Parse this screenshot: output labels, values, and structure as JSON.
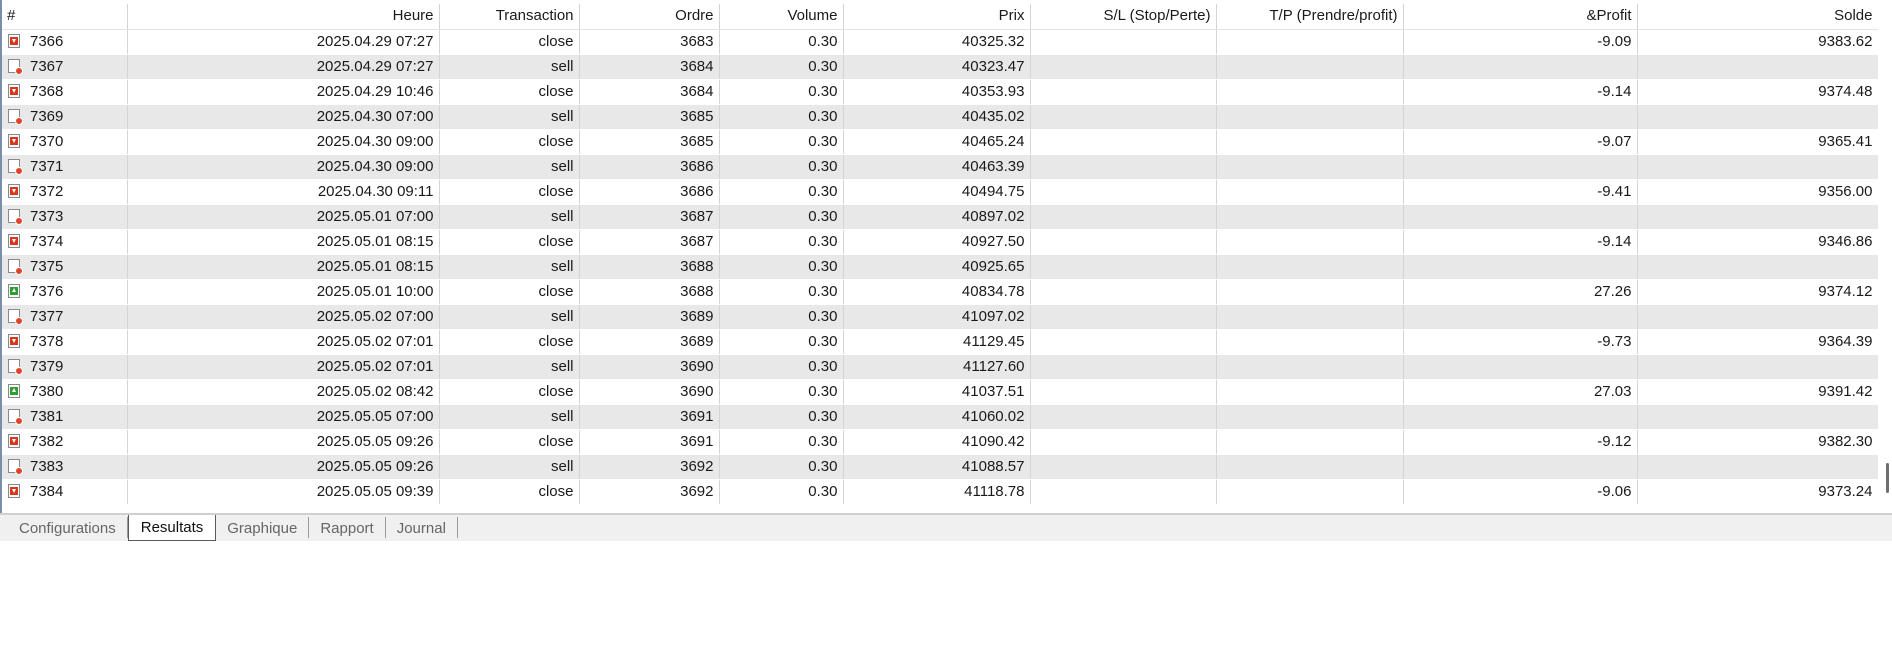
{
  "table": {
    "headers": {
      "id": "#",
      "time": "Heure",
      "transaction": "Transaction",
      "order": "Ordre",
      "volume": "Volume",
      "price": "Prix",
      "sl": "S/L (Stop/Perte)",
      "tp": "T/P (Prendre/profit)",
      "profit": "&Profit",
      "balance": "Solde"
    },
    "rows": [
      {
        "id": "7366",
        "icon": "loss",
        "time": "2025.04.29 07:27",
        "transaction": "close",
        "order": "3683",
        "volume": "0.30",
        "price": "40325.32",
        "sl": "",
        "tp": "",
        "profit": "-9.09",
        "balance": "9383.62"
      },
      {
        "id": "7367",
        "icon": "sell",
        "time": "2025.04.29 07:27",
        "transaction": "sell",
        "order": "3684",
        "volume": "0.30",
        "price": "40323.47",
        "sl": "",
        "tp": "",
        "profit": "",
        "balance": ""
      },
      {
        "id": "7368",
        "icon": "loss",
        "time": "2025.04.29 10:46",
        "transaction": "close",
        "order": "3684",
        "volume": "0.30",
        "price": "40353.93",
        "sl": "",
        "tp": "",
        "profit": "-9.14",
        "balance": "9374.48"
      },
      {
        "id": "7369",
        "icon": "sell",
        "time": "2025.04.30 07:00",
        "transaction": "sell",
        "order": "3685",
        "volume": "0.30",
        "price": "40435.02",
        "sl": "",
        "tp": "",
        "profit": "",
        "balance": ""
      },
      {
        "id": "7370",
        "icon": "loss",
        "time": "2025.04.30 09:00",
        "transaction": "close",
        "order": "3685",
        "volume": "0.30",
        "price": "40465.24",
        "sl": "",
        "tp": "",
        "profit": "-9.07",
        "balance": "9365.41"
      },
      {
        "id": "7371",
        "icon": "sell",
        "time": "2025.04.30 09:00",
        "transaction": "sell",
        "order": "3686",
        "volume": "0.30",
        "price": "40463.39",
        "sl": "",
        "tp": "",
        "profit": "",
        "balance": ""
      },
      {
        "id": "7372",
        "icon": "loss",
        "time": "2025.04.30 09:11",
        "transaction": "close",
        "order": "3686",
        "volume": "0.30",
        "price": "40494.75",
        "sl": "",
        "tp": "",
        "profit": "-9.41",
        "balance": "9356.00"
      },
      {
        "id": "7373",
        "icon": "sell",
        "time": "2025.05.01 07:00",
        "transaction": "sell",
        "order": "3687",
        "volume": "0.30",
        "price": "40897.02",
        "sl": "",
        "tp": "",
        "profit": "",
        "balance": ""
      },
      {
        "id": "7374",
        "icon": "loss",
        "time": "2025.05.01 08:15",
        "transaction": "close",
        "order": "3687",
        "volume": "0.30",
        "price": "40927.50",
        "sl": "",
        "tp": "",
        "profit": "-9.14",
        "balance": "9346.86"
      },
      {
        "id": "7375",
        "icon": "sell",
        "time": "2025.05.01 08:15",
        "transaction": "sell",
        "order": "3688",
        "volume": "0.30",
        "price": "40925.65",
        "sl": "",
        "tp": "",
        "profit": "",
        "balance": ""
      },
      {
        "id": "7376",
        "icon": "gain",
        "time": "2025.05.01 10:00",
        "transaction": "close",
        "order": "3688",
        "volume": "0.30",
        "price": "40834.78",
        "sl": "",
        "tp": "",
        "profit": "27.26",
        "balance": "9374.12"
      },
      {
        "id": "7377",
        "icon": "sell",
        "time": "2025.05.02 07:00",
        "transaction": "sell",
        "order": "3689",
        "volume": "0.30",
        "price": "41097.02",
        "sl": "",
        "tp": "",
        "profit": "",
        "balance": ""
      },
      {
        "id": "7378",
        "icon": "loss",
        "time": "2025.05.02 07:01",
        "transaction": "close",
        "order": "3689",
        "volume": "0.30",
        "price": "41129.45",
        "sl": "",
        "tp": "",
        "profit": "-9.73",
        "balance": "9364.39"
      },
      {
        "id": "7379",
        "icon": "sell",
        "time": "2025.05.02 07:01",
        "transaction": "sell",
        "order": "3690",
        "volume": "0.30",
        "price": "41127.60",
        "sl": "",
        "tp": "",
        "profit": "",
        "balance": ""
      },
      {
        "id": "7380",
        "icon": "gain",
        "time": "2025.05.02 08:42",
        "transaction": "close",
        "order": "3690",
        "volume": "0.30",
        "price": "41037.51",
        "sl": "",
        "tp": "",
        "profit": "27.03",
        "balance": "9391.42"
      },
      {
        "id": "7381",
        "icon": "sell",
        "time": "2025.05.05 07:00",
        "transaction": "sell",
        "order": "3691",
        "volume": "0.30",
        "price": "41060.02",
        "sl": "",
        "tp": "",
        "profit": "",
        "balance": ""
      },
      {
        "id": "7382",
        "icon": "loss",
        "time": "2025.05.05 09:26",
        "transaction": "close",
        "order": "3691",
        "volume": "0.30",
        "price": "41090.42",
        "sl": "",
        "tp": "",
        "profit": "-9.12",
        "balance": "9382.30"
      },
      {
        "id": "7383",
        "icon": "sell",
        "time": "2025.05.05 09:26",
        "transaction": "sell",
        "order": "3692",
        "volume": "0.30",
        "price": "41088.57",
        "sl": "",
        "tp": "",
        "profit": "",
        "balance": ""
      },
      {
        "id": "7384",
        "icon": "loss",
        "time": "2025.05.05 09:39",
        "transaction": "close",
        "order": "3692",
        "volume": "0.30",
        "price": "41118.78",
        "sl": "",
        "tp": "",
        "profit": "-9.06",
        "balance": "9373.24"
      }
    ]
  },
  "tabs": [
    {
      "label": "Configurations",
      "active": false
    },
    {
      "label": "Resultats",
      "active": true
    },
    {
      "label": "Graphique",
      "active": false
    },
    {
      "label": "Rapport",
      "active": false
    },
    {
      "label": "Journal",
      "active": false
    }
  ],
  "icons": {
    "loss": "close-loss-icon",
    "gain": "close-profit-icon",
    "sell": "sell-order-icon"
  },
  "colors": {
    "loss_red": "#d9361e",
    "gain_green": "#2e9e33",
    "alt_row": "#e8e8e8"
  }
}
